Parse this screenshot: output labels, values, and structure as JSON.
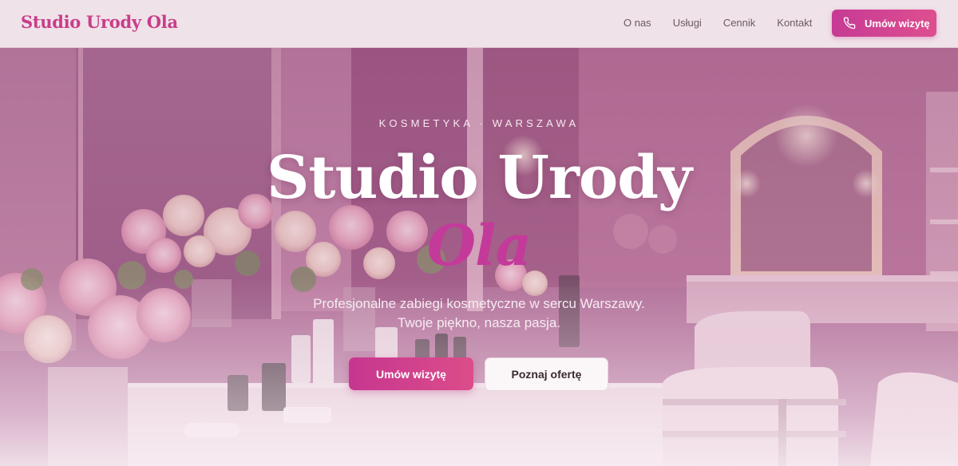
{
  "header": {
    "logo": "Studio Urody Ola",
    "nav": [
      {
        "label": "O nas"
      },
      {
        "label": "Usługi"
      },
      {
        "label": "Cennik"
      },
      {
        "label": "Kontakt"
      }
    ],
    "cta_label": "Umów wizytę",
    "cta_icon": "phone-icon"
  },
  "hero": {
    "eyebrow": "KOSMETYKA · WARSZAWA",
    "title_main": "Studio Urody",
    "title_accent": "Ola",
    "subtitle_line1": "Profesjonalne zabiegi kosmetyczne w sercu Warszawy.",
    "subtitle_line2": "Twoje piękno, nasza pasja.",
    "primary_button": "Umów wizytę",
    "secondary_button": "Poznaj ofertę",
    "background_image": "beauty-salon-interior-photo"
  },
  "colors": {
    "accent": "#c93d8a",
    "header_bg": "#efe2e9",
    "nav_text": "#6d5a62"
  }
}
